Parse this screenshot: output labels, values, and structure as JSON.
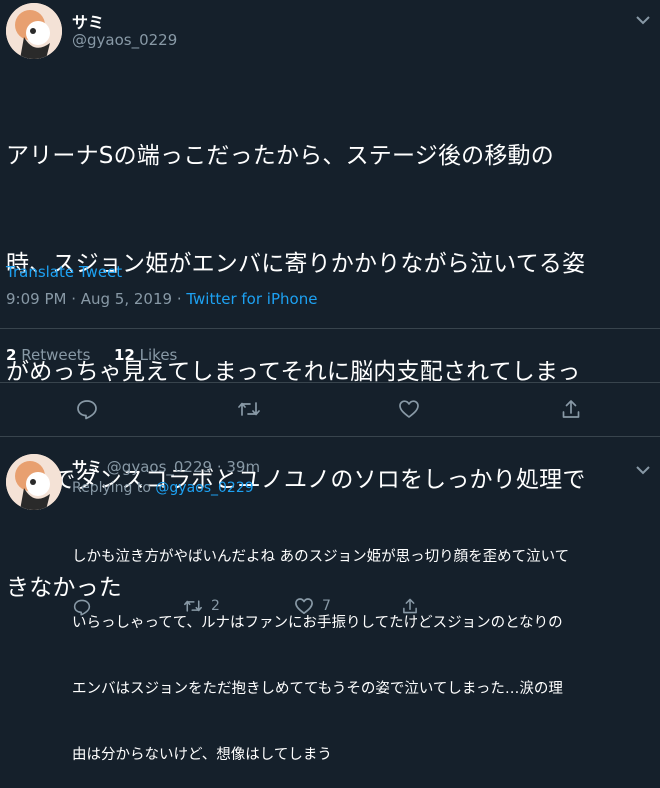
{
  "tweet": {
    "display_name": "サミ",
    "handle": "@gyaos_0229",
    "text_lines": [
      "アリーナSの端っこだったから、ステージ後の移動の",
      "時、スジョン姫がエンバに寄りかかりながら泣いてる姿",
      "がめっちゃ見えてしまってそれに脳内支配されてしまっ",
      "たのでダンスコラボとユノユノのソロをしっかり処理で",
      "きなかった"
    ],
    "translate_label": "Translate Tweet",
    "time": "9:09 PM · Aug 5, 2019 · ",
    "source": "Twitter for iPhone",
    "retweets_count": "2",
    "retweets_label": "Retweets",
    "likes_count": "12",
    "likes_label": "Likes"
  },
  "reply": {
    "display_name": "サミ",
    "handle_time": "@gyaos_0229 · 39m",
    "replying_prefix": "Replying to ",
    "replying_handle": "@gyaos_0229",
    "text_lines": [
      "しかも泣き方がやばいんだよね あのスジョン姫が思っ切り顔を歪めて泣いて",
      "いらっしゃってて、ルナはファンにお手振りしてたけどスジョンのとなりの",
      "エンバはスジョンをただ抱きしめててもうその姿で泣いてしまった…涙の理",
      "由は分からないけど、想像はしてしまう"
    ],
    "retweet_count": "2",
    "like_count": "7"
  },
  "icons": {
    "reply": "comment-icon",
    "retweet": "retweet-icon",
    "like": "heart-icon",
    "share": "share-icon",
    "more": "chevron-down-icon"
  },
  "colors": {
    "background": "#15202b",
    "accent": "#1da1f2",
    "muted": "#8899a6",
    "divider": "#38444d"
  }
}
